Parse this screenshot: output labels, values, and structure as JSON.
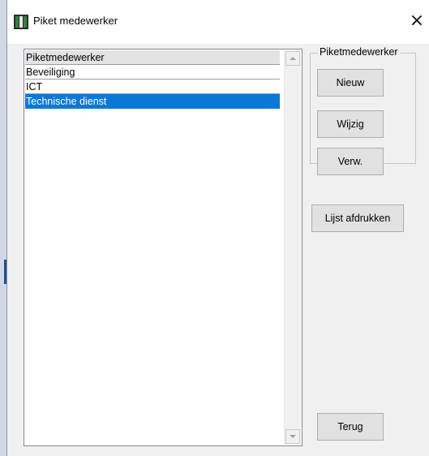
{
  "window": {
    "title": "Piket medewerker",
    "close_glyph": "×"
  },
  "list": {
    "header": "Piketmedewerker",
    "items": [
      "Beveiliging",
      "ICT",
      "Technische dienst"
    ],
    "selected_index": 2
  },
  "group": {
    "label": "Piketmedewerker",
    "buttons": {
      "new": "Nieuw",
      "edit": "Wijzig",
      "delete": "Verw."
    }
  },
  "buttons": {
    "print": "Lijst afdrukken",
    "back": "Terug"
  },
  "colors": {
    "selection": "#0a78d7",
    "button_face": "#e1e1e1",
    "dialog_bg": "#f0f0f0"
  }
}
